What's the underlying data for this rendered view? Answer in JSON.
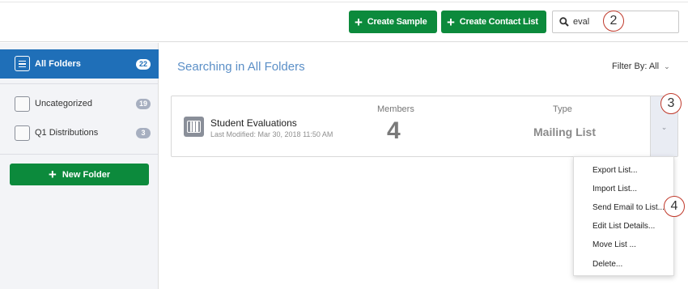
{
  "header": {
    "create_sample": "Create Sample",
    "create_contact_list": "Create Contact List",
    "search_value": "eval"
  },
  "callouts": [
    "2",
    "3",
    "4"
  ],
  "sidebar": {
    "active": {
      "label": "All Folders",
      "count": "22"
    },
    "items": [
      {
        "label": "Uncategorized",
        "count": "19"
      },
      {
        "label": "Q1 Distributions",
        "count": "3"
      }
    ],
    "new_folder": "New Folder"
  },
  "main": {
    "title": "Searching in All Folders",
    "filter": "Filter By: All",
    "card": {
      "name": "Student Evaluations",
      "modified": "Last Modified: Mar 30, 2018 11:50 AM",
      "members_label": "Members",
      "members_value": "4",
      "type_label": "Type",
      "type_value": "Mailing List"
    }
  },
  "menu": {
    "items": [
      "Export List...",
      "Import List...",
      "Send Email to List...",
      "Edit List Details...",
      "Move List ...",
      "Delete..."
    ]
  },
  "colors": {
    "brand_green": "#0c8a3c",
    "active_blue": "#1f6fb8",
    "title_blue": "#5b8fc7",
    "callout_red": "#c0392b"
  }
}
